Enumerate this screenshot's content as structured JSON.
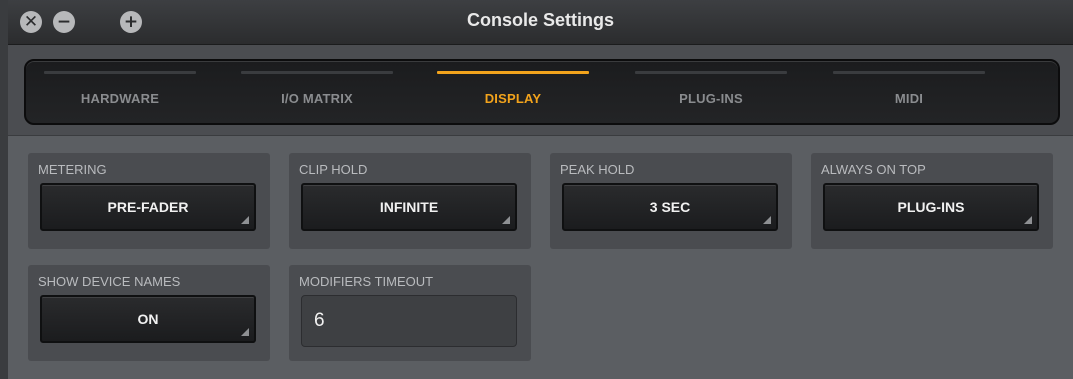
{
  "window": {
    "title": "Console Settings",
    "controls": [
      "close-icon",
      "minimize-icon",
      "zoom-icon"
    ]
  },
  "tabs": [
    {
      "label": "HARDWARE",
      "active": false
    },
    {
      "label": "I/O MATRIX",
      "active": false
    },
    {
      "label": "DISPLAY",
      "active": true
    },
    {
      "label": "PLUG-INS",
      "active": false
    },
    {
      "label": "MIDI",
      "active": false
    }
  ],
  "settings": {
    "metering": {
      "label": "METERING",
      "value": "PRE-FADER"
    },
    "clip_hold": {
      "label": "CLIP HOLD",
      "value": "INFINITE"
    },
    "peak_hold": {
      "label": "PEAK HOLD",
      "value": "3 SEC"
    },
    "always_on_top": {
      "label": "ALWAYS ON TOP",
      "value": "PLUG-INS"
    },
    "show_device_names": {
      "label": "SHOW DEVICE NAMES",
      "value": "ON"
    },
    "modifiers_timeout": {
      "label": "MODIFIERS TIMEOUT",
      "value": "6"
    }
  },
  "colors": {
    "accent": "#f2a31c",
    "background": "#5b5e62",
    "panel": "#4a4c50",
    "inactive_tab_text": "#8a8c8f"
  }
}
